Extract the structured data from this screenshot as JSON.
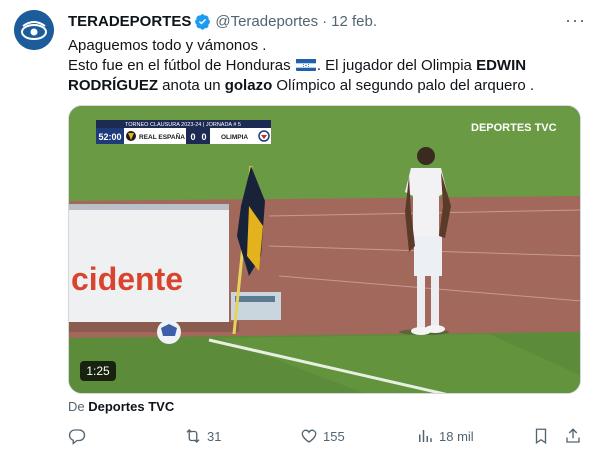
{
  "tweet": {
    "display_name": "TERADEPORTES",
    "handle": "@Teradeportes",
    "separator": "·",
    "date": "12 feb.",
    "more": "···",
    "text_line1": "Apaguemos todo y vámonos .",
    "text_line2_pre": "Esto fue en el fútbol de Honduras",
    "text_line2_post": ". El jugador del Olimpia",
    "bold_name": "EDWIN RODRÍGUEZ",
    "text_mid": "anota un",
    "bold_goal": "golazo",
    "text_end": "Olímpico al segundo palo del arquero ."
  },
  "media": {
    "scorebug_title": "TORNEO CLAUSURA 2023-24 | JORNADA # 5",
    "clock": "52:00",
    "home_team": "REAL ESPAÑA",
    "home_score": "0",
    "away_score": "0",
    "away_team": "OLIMPIA",
    "broadcaster_logo": "DEPORTES TVC",
    "ad_board_text": "cidente",
    "duration": "1:25"
  },
  "source": {
    "prefix": "De",
    "name": "Deportes TVC"
  },
  "actions": {
    "replies": "",
    "retweets": "31",
    "likes": "155",
    "views": "18 mil"
  },
  "colors": {
    "accent": "#1d9bf0",
    "muted": "#536471",
    "text": "#0f1419"
  }
}
